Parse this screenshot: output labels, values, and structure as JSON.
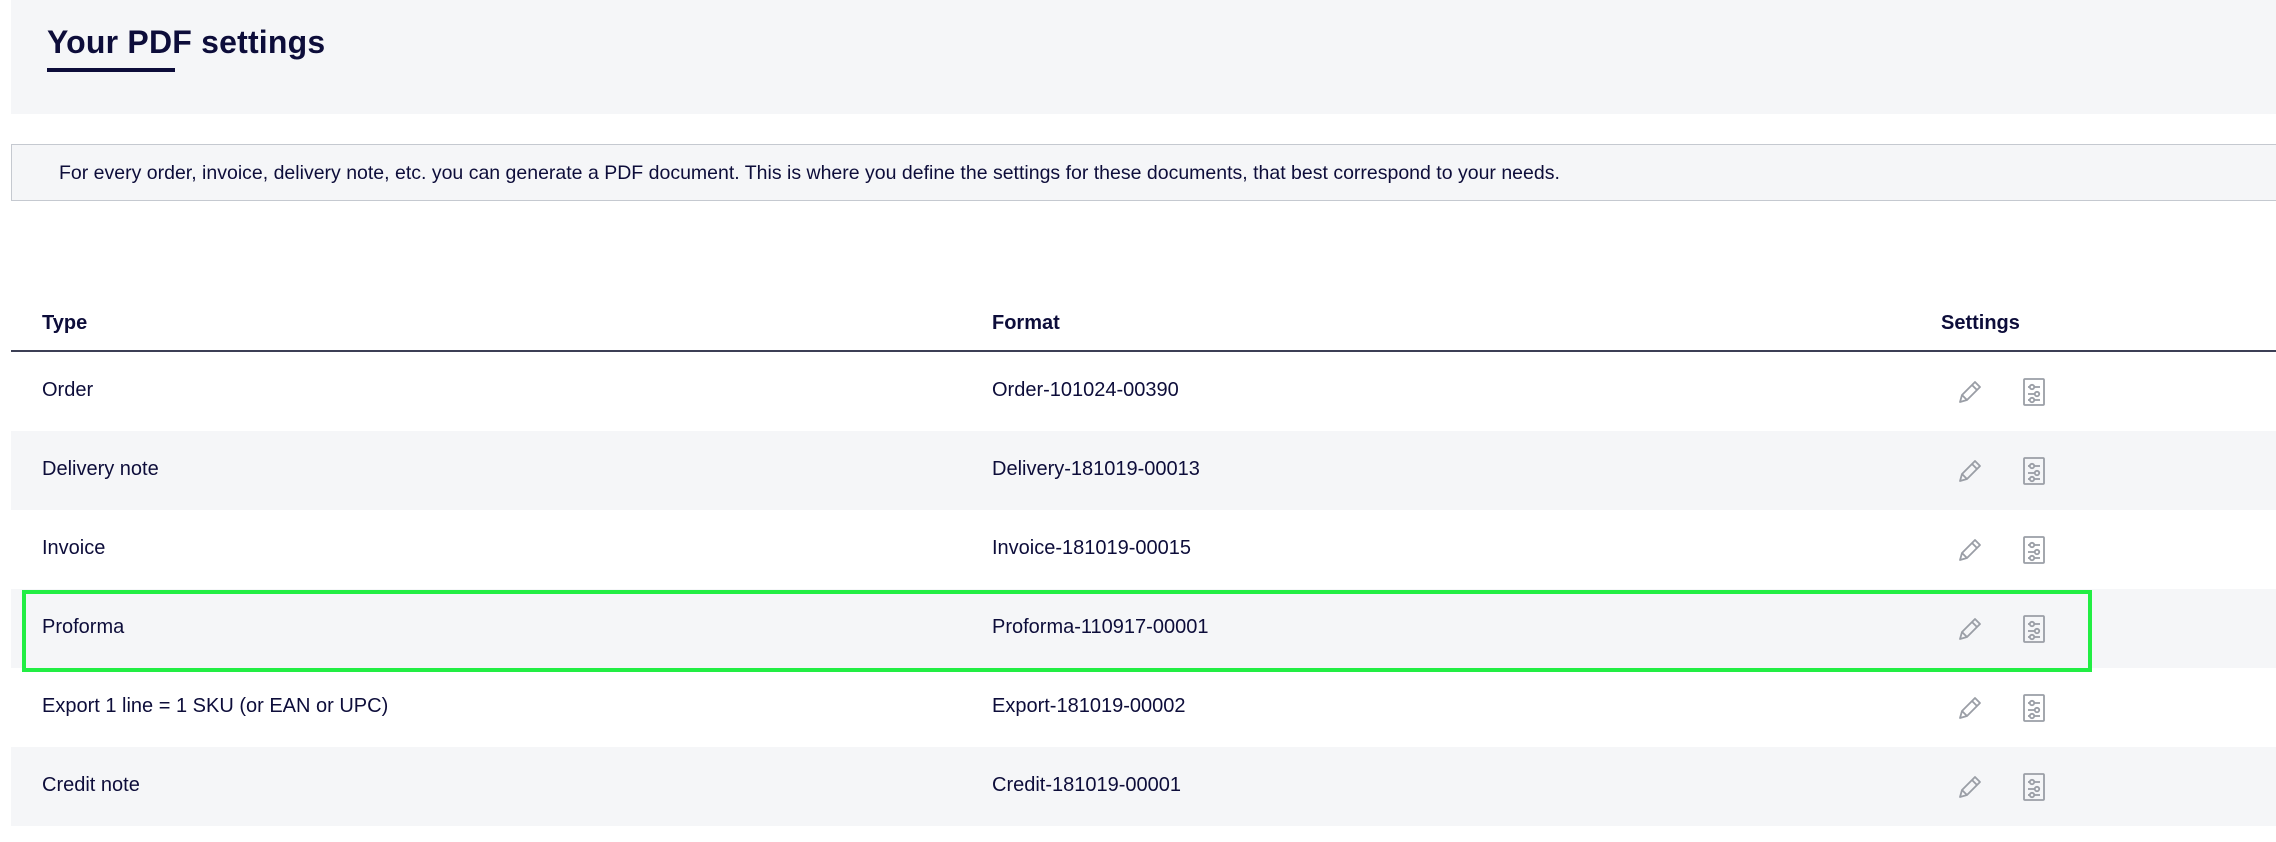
{
  "header": {
    "title": "Your PDF settings"
  },
  "info": {
    "text": "For every order, invoice, delivery note, etc. you can generate a PDF document. This is where you define the settings for these documents, that best correspond to your needs."
  },
  "table": {
    "columns": {
      "type": "Type",
      "format": "Format",
      "settings": "Settings"
    },
    "rows": [
      {
        "type": "Order",
        "format": "Order-101024-00390"
      },
      {
        "type": "Delivery note",
        "format": "Delivery-181019-00013"
      },
      {
        "type": "Invoice",
        "format": "Invoice-181019-00015"
      },
      {
        "type": "Proforma",
        "format": "Proforma-110917-00001"
      },
      {
        "type": "Export 1 line = 1 SKU (or EAN or UPC)",
        "format": "Export-181019-00002"
      },
      {
        "type": "Credit note",
        "format": "Credit-181019-00001"
      }
    ],
    "row_actions": [
      "pencil-icon",
      "document-settings-icon"
    ],
    "highlighted_row": "Proforma"
  },
  "colors": {
    "text": "#0d0d3a",
    "panel_bg": "#f5f6f8",
    "icon": "#9a9ea6",
    "highlight": "#22ee44"
  }
}
